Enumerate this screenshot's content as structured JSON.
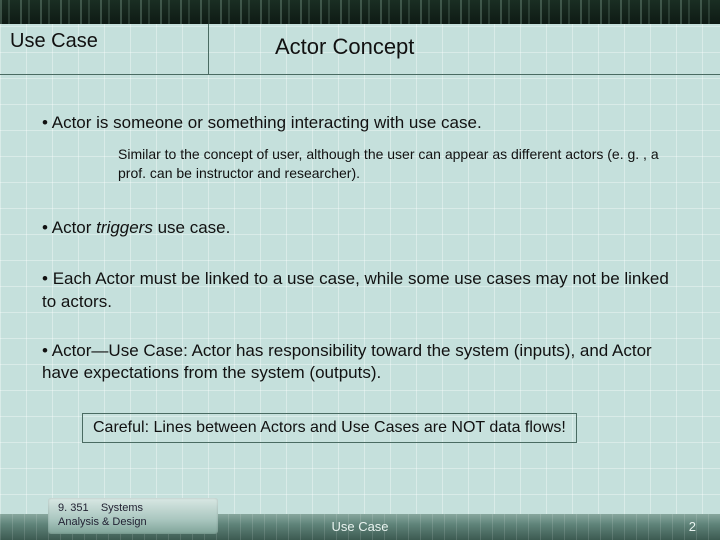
{
  "header": {
    "left": "Use Case",
    "center": "Actor Concept"
  },
  "bullets": {
    "b1": "Actor is someone or something interacting with use case.",
    "sub1": "Similar to the concept of user, although the user can appear as different actors (e. g. , a prof. can be instructor and researcher).",
    "b2_prefix": "Actor ",
    "b2_em": "triggers",
    "b2_suffix": " use case.",
    "b3": "Each Actor must be linked to a use case, while some use cases may not be linked to actors.",
    "b4": "Actor—Use Case: Actor has responsibility toward the system (inputs), and Actor have expectations from the system (outputs)."
  },
  "careful": "Careful: Lines between Actors and Use Cases are NOT data flows!",
  "footer": {
    "course_code": "9. 351",
    "course_name": "Systems",
    "course_line2": "Analysis & Design",
    "center": "Use Case",
    "page": "2"
  }
}
